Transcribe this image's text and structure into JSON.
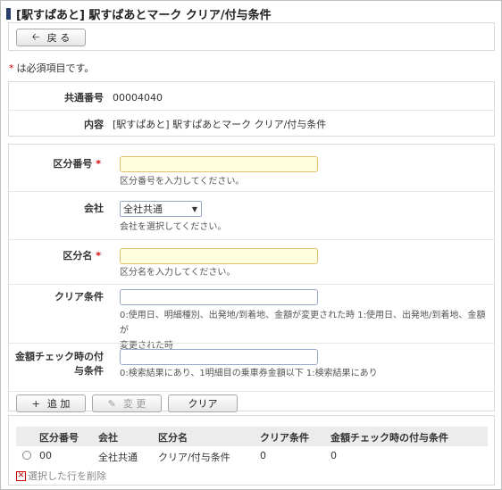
{
  "title": "[駅すぱあと] 駅すぱあとマーク クリア/付与条件",
  "header": {
    "back_label": "戻 る"
  },
  "required_note": "は必須項目です。",
  "required_mark": "*",
  "info": {
    "common_no_label": "共通番号",
    "common_no_value": "00004040",
    "content_label": "内容",
    "content_value": "[駅すぱあと] 駅すぱあとマーク クリア/付与条件"
  },
  "form": {
    "division_no": {
      "label": "区分番号",
      "value": "",
      "hint": "区分番号を入力してください。"
    },
    "company": {
      "label": "会社",
      "selected": "全社共通",
      "hint": "会社を選択してください。"
    },
    "division_name": {
      "label": "区分名",
      "value": "",
      "hint": "区分名を入力してください。"
    },
    "clear_condition": {
      "label": "クリア条件",
      "value": "",
      "hint_line1": "0:使用日、明細種別、出発地/到着地、金額が変更された時 1:使用日、出発地/到着地、金額が",
      "hint_line2": "変更された時"
    },
    "amount_check": {
      "label_line1": "金額チェック時の付",
      "label_line2": "与条件",
      "value": "",
      "hint": "0:検索結果にあり、1明細目の乗車券金額以下 1:検索結果にあり"
    }
  },
  "actions": {
    "add_label": "追 加",
    "edit_label": "変 更",
    "clear_label": "クリア"
  },
  "table": {
    "headers": [
      "区分番号",
      "会社",
      "区分名",
      "クリア条件",
      "金額チェック時の付与条件"
    ],
    "rows": [
      [
        "00",
        "全社共通",
        "クリア/付与条件",
        "0",
        "0"
      ]
    ],
    "delete_label": "選択した行を削除"
  }
}
